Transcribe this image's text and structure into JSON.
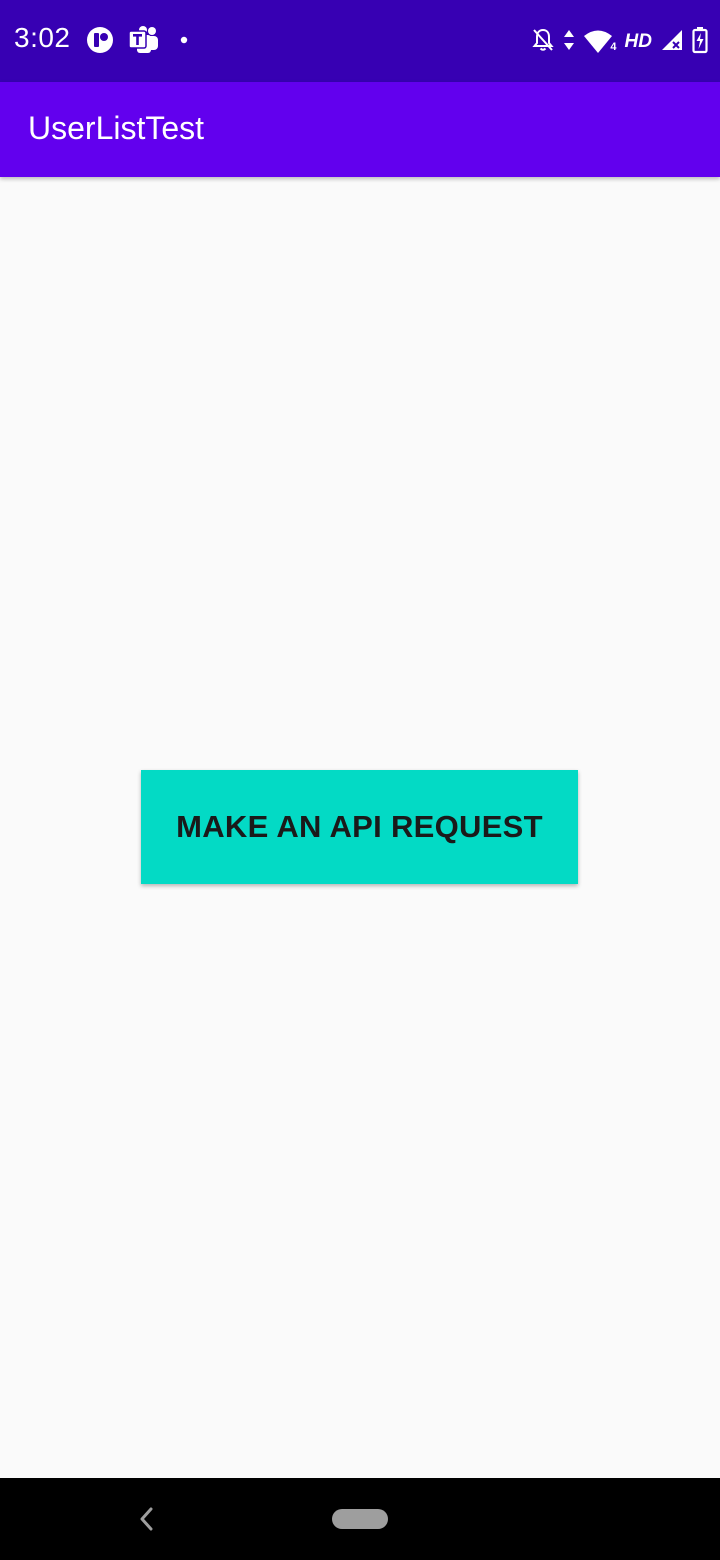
{
  "status_bar": {
    "time": "3:02",
    "left_icons": [
      "rounded-r-app-icon",
      "teams-icon",
      "dot-icon"
    ],
    "right_icons": [
      "bell-off-icon",
      "data-arrows-icon",
      "wifi-icon",
      "signal-icon",
      "battery-charging-icon"
    ],
    "network_label": "HD",
    "wifi_badge": "4",
    "background_color": "#3700b3"
  },
  "app_bar": {
    "title": "UserListTest",
    "background_color": "#6200ee"
  },
  "main": {
    "button_label": "MAKE AN API REQUEST",
    "button_color": "#03dac5",
    "background_color": "#fafafa"
  },
  "nav_bar": {
    "icons": [
      "back-icon",
      "home-pill-icon"
    ],
    "background_color": "#000000"
  }
}
